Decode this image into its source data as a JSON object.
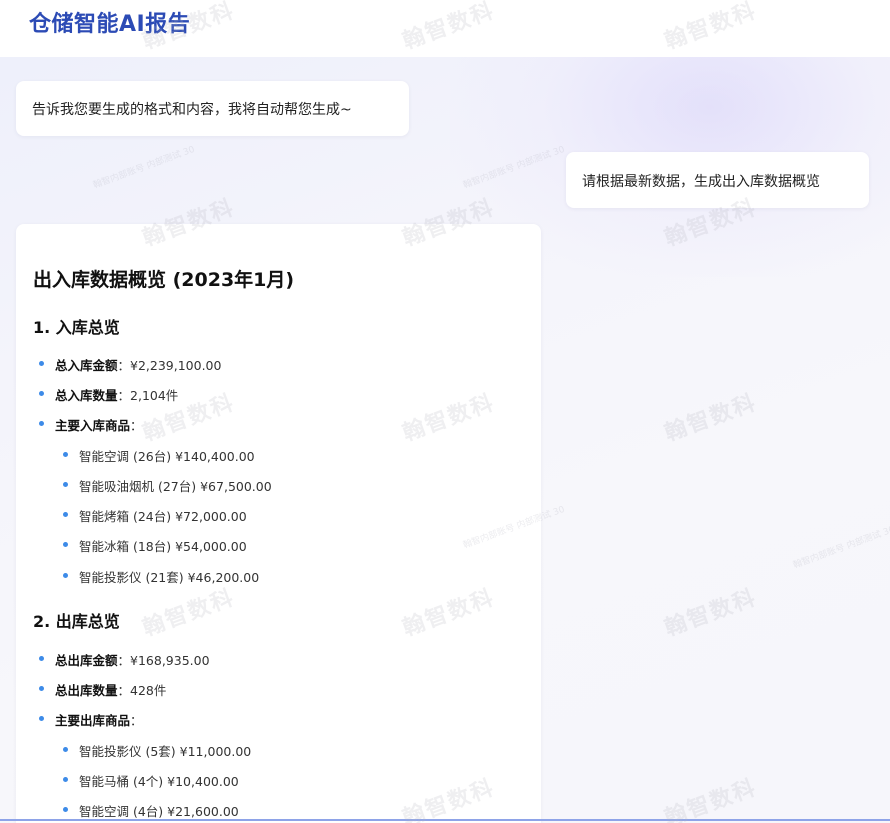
{
  "header": {
    "title": "仓储智能AI报告"
  },
  "chat": {
    "bot_greeting": "告诉我您要生成的格式和内容，我将自动帮您生成~",
    "user_message": "请根据最新数据，生成出入库数据概览"
  },
  "report": {
    "title": "出入库数据概览 (2023年1月)",
    "inbound": {
      "heading": "1. 入库总览",
      "total_amount_label": "总入库金额",
      "total_amount_value": "：¥2,239,100.00",
      "total_qty_label": "总入库数量",
      "total_qty_value": "：2,104件",
      "main_goods_label": "主要入库商品",
      "main_goods_colon": "：",
      "goods": [
        "智能空调 (26台) ¥140,400.00",
        "智能吸油烟机 (27台) ¥67,500.00",
        "智能烤箱 (24台) ¥72,000.00",
        "智能冰箱 (18台) ¥54,000.00",
        "智能投影仪 (21套) ¥46,200.00"
      ]
    },
    "outbound": {
      "heading": "2. 出库总览",
      "total_amount_label": "总出库金额",
      "total_amount_value": "：¥168,935.00",
      "total_qty_label": "总出库数量",
      "total_qty_value": "：428件",
      "main_goods_label": "主要出库商品",
      "main_goods_colon": "：",
      "goods": [
        "智能投影仪 (5套) ¥11,000.00",
        "智能马桶 (4个) ¥10,400.00",
        "智能空调 (4台) ¥21,600.00"
      ]
    }
  },
  "watermark": {
    "large": "翰智数科",
    "small": "翰智内部账号 内部测试 30"
  },
  "colors": {
    "accent": "#2c4bb5",
    "bullet": "#3d8be8"
  }
}
